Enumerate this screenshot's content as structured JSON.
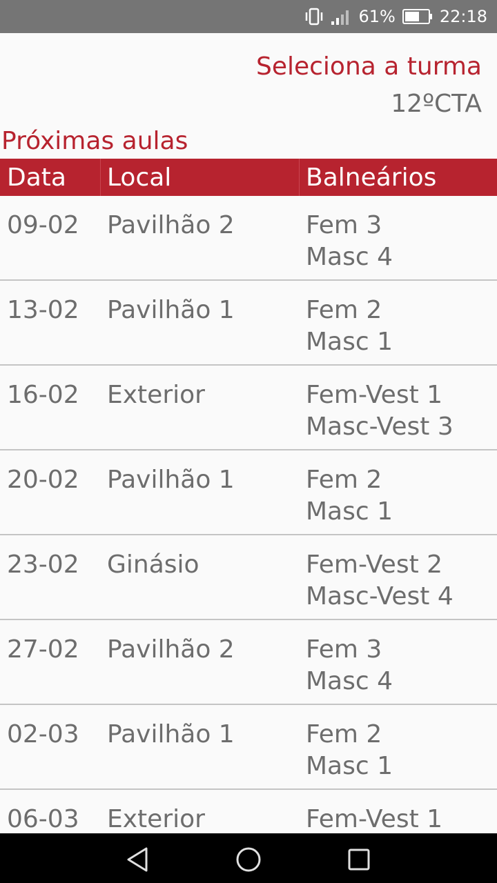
{
  "status_bar": {
    "battery_percent": "61%",
    "time": "22:18",
    "icons": [
      "vibrate-icon",
      "signal-icon",
      "battery-icon"
    ]
  },
  "header": {
    "select_label": "Seleciona a turma",
    "selected_class": "12ºCTA"
  },
  "section": {
    "title": "Próximas aulas"
  },
  "table": {
    "columns": [
      "Data",
      "Local",
      "Balneários"
    ],
    "rows": [
      {
        "date": "09-02",
        "local": "Pavilhão 2",
        "bal1": "Fem 3",
        "bal2": "Masc 4"
      },
      {
        "date": "13-02",
        "local": "Pavilhão 1",
        "bal1": "Fem 2",
        "bal2": "Masc 1"
      },
      {
        "date": "16-02",
        "local": "Exterior",
        "bal1": "Fem-Vest 1",
        "bal2": "Masc-Vest 3"
      },
      {
        "date": "20-02",
        "local": "Pavilhão 1",
        "bal1": "Fem 2",
        "bal2": "Masc 1"
      },
      {
        "date": "23-02",
        "local": "Ginásio",
        "bal1": "Fem-Vest 2",
        "bal2": "Masc-Vest 4"
      },
      {
        "date": "27-02",
        "local": "Pavilhão 2",
        "bal1": "Fem 3",
        "bal2": "Masc 4"
      },
      {
        "date": "02-03",
        "local": "Pavilhão 1",
        "bal1": "Fem 2",
        "bal2": "Masc 1"
      },
      {
        "date": "06-03",
        "local": "Exterior",
        "bal1": "Fem-Vest 1",
        "bal2": ""
      }
    ]
  },
  "nav_bar": {
    "icons": [
      "back-icon",
      "home-icon",
      "recent-apps-icon"
    ]
  },
  "colors": {
    "accent": "#b7232f",
    "text_gray": "#6d6d6d",
    "status_bar_bg": "#757575",
    "background": "#fafafa"
  }
}
